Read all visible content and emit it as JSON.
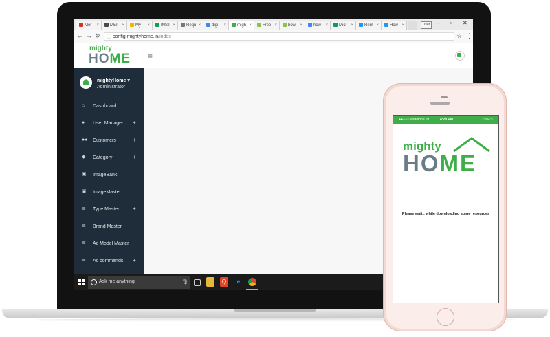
{
  "browser": {
    "tabs": [
      {
        "label": "Mer",
        "color": "#d93025",
        "icon": "gmail-icon"
      },
      {
        "label": "MEI",
        "color": "#4a4a4a",
        "icon": "page-icon"
      },
      {
        "label": "My",
        "color": "#f4b400",
        "icon": "drive-icon"
      },
      {
        "label": "INST",
        "color": "#0f9d58",
        "icon": "sheets-icon"
      },
      {
        "label": "Requ",
        "color": "#777777",
        "icon": "page-icon"
      },
      {
        "label": "digi",
        "color": "#4285f4",
        "icon": "google-icon"
      },
      {
        "label": "migh",
        "color": "#3fae49",
        "icon": "mightyhome-icon"
      },
      {
        "label": "Free",
        "color": "#8bc34a",
        "icon": "chat-icon"
      },
      {
        "label": "how",
        "color": "#8bc34a",
        "icon": "chat-icon"
      },
      {
        "label": "how",
        "color": "#4285f4",
        "icon": "google-icon"
      },
      {
        "label": "Micr",
        "color": "#0f9d58",
        "icon": "play-icon"
      },
      {
        "label": "Rem",
        "color": "#2196f3",
        "icon": "loading-icon"
      },
      {
        "label": "How",
        "color": "#2196f3",
        "icon": "loading-icon"
      }
    ],
    "active_tab": 6,
    "url_host": "config.mightyhome.in",
    "url_path": "/index",
    "user_chip": "User"
  },
  "app": {
    "logo_small": "mighty",
    "logo_big_a": "HO",
    "logo_big_b": "ME",
    "user": {
      "name": "mightyHome",
      "role": "Administrator"
    },
    "menu": [
      {
        "label": "Dashboard",
        "icon": "home-icon",
        "plus": false
      },
      {
        "label": "User Manager",
        "icon": "person-icon",
        "plus": true
      },
      {
        "label": "Customers",
        "icon": "people-icon",
        "plus": true
      },
      {
        "label": "Category",
        "icon": "layers-icon",
        "plus": true
      },
      {
        "label": "ImageBank",
        "icon": "image-icon",
        "plus": false
      },
      {
        "label": "ImageMaster",
        "icon": "image-icon",
        "plus": false
      },
      {
        "label": "Type Master",
        "icon": "list-icon",
        "plus": true
      },
      {
        "label": "Brand Master",
        "icon": "list-icon",
        "plus": false
      },
      {
        "label": "Ac Model Master",
        "icon": "list-icon",
        "plus": false
      },
      {
        "label": "Ac commands",
        "icon": "list-icon",
        "plus": true
      }
    ]
  },
  "taskbar": {
    "search_placeholder": "Ask me anything"
  },
  "phone": {
    "carrier": "●●○○○ Vodafone IN",
    "time": "4:28 PM",
    "battery": "23%",
    "logo_small": "mighty",
    "logo_big_a": "HO",
    "logo_big_b": "ME",
    "wait_text": "Please wait.. while downloading some resources"
  },
  "colors": {
    "brand_green": "#3fae49",
    "sidebar_bg": "#1f2d3a",
    "logo_grey": "#6a7d87"
  }
}
